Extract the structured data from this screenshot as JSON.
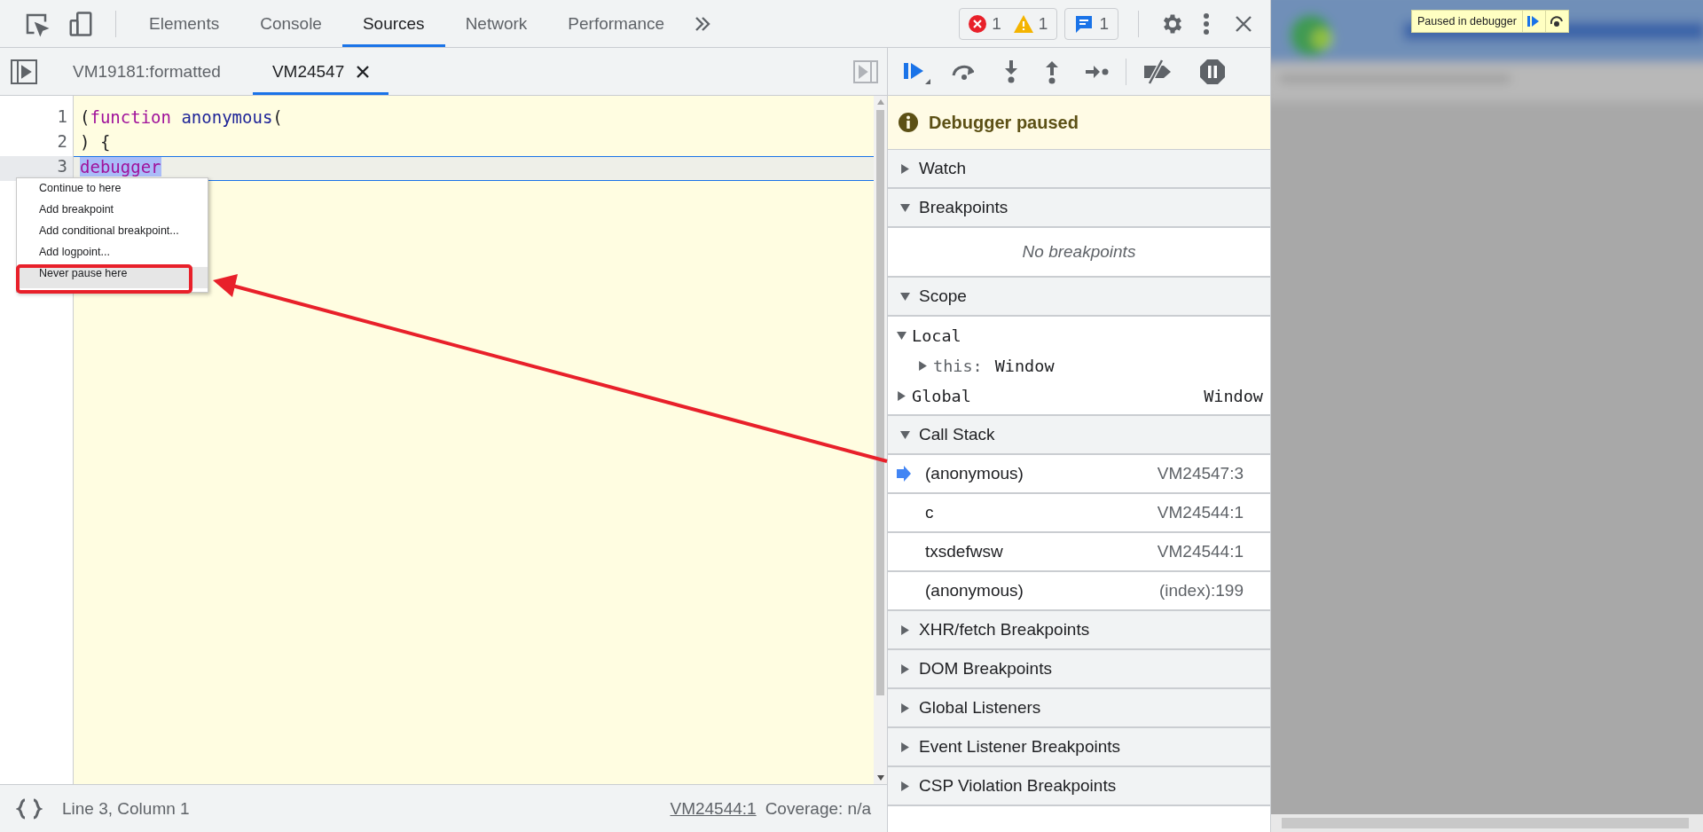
{
  "main_tabs": [
    {
      "label": "Elements",
      "selected": false
    },
    {
      "label": "Console",
      "selected": false
    },
    {
      "label": "Sources",
      "selected": true
    },
    {
      "label": "Network",
      "selected": false
    },
    {
      "label": "Performance",
      "selected": false
    }
  ],
  "counters": {
    "errors": "1",
    "warnings": "1",
    "messages": "1"
  },
  "file_tabs": [
    {
      "label": "VM19181:formatted",
      "selected": false,
      "closable": false
    },
    {
      "label": "VM24547",
      "selected": true,
      "closable": true
    }
  ],
  "code_lines": [
    {
      "number": "1",
      "current": false,
      "tokens": [
        {
          "kind": "plain",
          "text": "(",
          "selected": false
        },
        {
          "kind": "keyword",
          "text": "function",
          "selected": false
        },
        {
          "kind": "def",
          "text": " anonymous",
          "selected": false
        },
        {
          "kind": "plain",
          "text": "(",
          "selected": false
        }
      ]
    },
    {
      "number": "2",
      "current": false,
      "tokens": [
        {
          "kind": "plain",
          "text": ") {",
          "selected": false
        }
      ]
    },
    {
      "number": "3",
      "current": true,
      "tokens": [
        {
          "kind": "keyword",
          "text": "debugger",
          "selected": true
        }
      ]
    }
  ],
  "context_menu": {
    "items": [
      {
        "label": "Continue to here",
        "highlighted": false
      },
      {
        "label": "Add breakpoint",
        "highlighted": false
      },
      {
        "label": "Add conditional breakpoint...",
        "highlighted": false
      },
      {
        "label": "Add logpoint...",
        "highlighted": false
      },
      {
        "label": "Never pause here",
        "highlighted": true
      }
    ]
  },
  "status_bar": {
    "position": "Line 3, Column 1",
    "source_link": "VM24544:1",
    "coverage": "Coverage: n/a"
  },
  "sidebar": {
    "paused_banner": "Debugger paused",
    "sections": [
      {
        "title": "Watch",
        "expanded": false
      },
      {
        "title": "Breakpoints",
        "expanded": true,
        "empty_text": "No breakpoints"
      },
      {
        "title": "Scope",
        "expanded": true,
        "scope": [
          {
            "name": "Local",
            "expanded": true,
            "children": [
              {
                "name": "this:",
                "value": "Window",
                "expanded": false
              }
            ]
          },
          {
            "name": "Global",
            "value": "Window",
            "expanded": false
          }
        ]
      },
      {
        "title": "Call Stack",
        "expanded": true,
        "frames": [
          {
            "function": "(anonymous)",
            "location": "VM24547:3",
            "current": true
          },
          {
            "function": "c",
            "location": "VM24544:1",
            "current": false
          },
          {
            "function": "txsdefwsw",
            "location": "VM24544:1",
            "current": false
          },
          {
            "function": "(anonymous)",
            "location": "(index):199",
            "current": false
          }
        ]
      },
      {
        "title": "XHR/fetch Breakpoints",
        "expanded": false
      },
      {
        "title": "DOM Breakpoints",
        "expanded": false
      },
      {
        "title": "Global Listeners",
        "expanded": false
      },
      {
        "title": "Event Listener Breakpoints",
        "expanded": false
      },
      {
        "title": "CSP Violation Breakpoints",
        "expanded": false
      }
    ]
  },
  "page_overlay": {
    "label": "Paused in debugger"
  }
}
